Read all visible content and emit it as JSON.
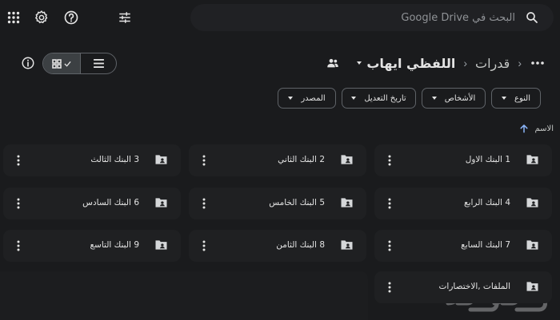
{
  "search": {
    "placeholder": "البحث في Google Drive"
  },
  "icons": {
    "search": "search-icon",
    "tune": "tune-icon",
    "help": "help-icon",
    "settings": "settings-icon",
    "apps": "apps-grid-icon",
    "more": "more-horizontal-icon",
    "shared": "shared-users-icon",
    "info": "info-icon",
    "grid": "grid-view-icon",
    "list": "list-view-icon",
    "folder": "shared-folder-icon",
    "kebab": "more-vertical-icon",
    "sort": "arrow-up-icon"
  },
  "breadcrumb": {
    "parent": "قدرات",
    "current": "اللفظي ايهاب"
  },
  "filters": {
    "type": "النوع",
    "people": "الأشخاص",
    "modified": "تاريخ التعديل",
    "source": "المصدر"
  },
  "sort": {
    "label": "الاسم"
  },
  "folders": [
    {
      "name": "1 البنك الاول"
    },
    {
      "name": "2 البنك الثاني"
    },
    {
      "name": "3 البنك الثالث"
    },
    {
      "name": "4 البنك الرابع"
    },
    {
      "name": "5 البنك الخامس"
    },
    {
      "name": "6 البنك السادس"
    },
    {
      "name": "7 البنك السابع"
    },
    {
      "name": "8 البنك الثامن"
    },
    {
      "name": "9 البنك التاسع"
    },
    {
      "name": "الملفات ,الاختصارات"
    }
  ],
  "watermark": "حراج",
  "colors": {
    "background": "#1a1b1d",
    "card": "#1f2022",
    "text": "#e3e3e3",
    "border": "#5f6368"
  }
}
